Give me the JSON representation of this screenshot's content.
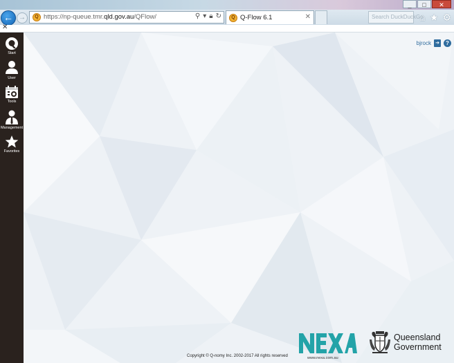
{
  "browser": {
    "window_buttons": [
      "_",
      "□",
      "✕"
    ],
    "address": {
      "prefix": "https://np-queue.tmr.",
      "domain": "qld.gov.au",
      "path": "/QFlow/"
    },
    "tab": {
      "title": "Q-Flow 6.1",
      "close": "✕"
    },
    "search_placeholder": "Search DuckDuckGo",
    "favbar_close": "✕",
    "icons": [
      "home-icon",
      "star-icon",
      "gear-icon"
    ]
  },
  "sidebar": {
    "items": [
      {
        "label": "Start",
        "icon": "q-logo-icon"
      },
      {
        "label": "User",
        "icon": "user-icon"
      },
      {
        "label": "Tools",
        "icon": "tools-icon"
      },
      {
        "label": "Management",
        "icon": "management-icon"
      },
      {
        "label": "Favorites",
        "icon": "star-icon"
      }
    ]
  },
  "header": {
    "username": "bjrock"
  },
  "footer": {
    "copyright": "Copyright © Q-nomy Inc. 2002-2017 All rights reserved",
    "nexa_url": "www.nexa.com.au",
    "qld_line1": "Queensland",
    "qld_line2": "Government"
  },
  "colors": {
    "sidebar": "#2a221e",
    "accent": "#2f6c9e",
    "nexa": "#23a3a8"
  }
}
